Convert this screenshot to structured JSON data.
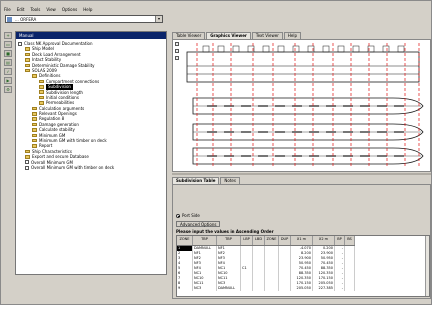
{
  "menu": [
    "File",
    "Edit",
    "Tools",
    "View",
    "Options",
    "Help"
  ],
  "project": {
    "name": "... ORFERA"
  },
  "toolbar_icons": [
    "new-icon",
    "open-icon",
    "save-icon",
    "print-icon",
    "check-icon",
    "run-icon",
    "settings-icon"
  ],
  "tree": {
    "header": "Manual",
    "items": [
      {
        "label": "Class NK Approval Documentation",
        "level": 0,
        "kind": "doc"
      },
      {
        "label": "Ship Model",
        "level": 1,
        "kind": "folder"
      },
      {
        "label": "Deck Load Arrangement",
        "level": 1,
        "kind": "folder"
      },
      {
        "label": "Intact Stability",
        "level": 1,
        "kind": "folder"
      },
      {
        "label": "Deterministic Damage Stability",
        "level": 1,
        "kind": "folder"
      },
      {
        "label": "SOLAS 2009",
        "level": 1,
        "kind": "folder"
      },
      {
        "label": "Definitions",
        "level": 2,
        "kind": "folder"
      },
      {
        "label": "Compartment connections",
        "level": 3,
        "kind": "folder"
      },
      {
        "label": "Subdivision",
        "level": 3,
        "kind": "folder",
        "selected": true
      },
      {
        "label": "Subdivision length",
        "level": 3,
        "kind": "folder"
      },
      {
        "label": "Initial conditions",
        "level": 3,
        "kind": "folder"
      },
      {
        "label": "Permeabilities",
        "level": 3,
        "kind": "folder"
      },
      {
        "label": "Calculation arguments",
        "level": 2,
        "kind": "folder"
      },
      {
        "label": "Relevant Openings",
        "level": 2,
        "kind": "folder"
      },
      {
        "label": "Regulation 8",
        "level": 2,
        "kind": "folder"
      },
      {
        "label": "Damage generation",
        "level": 2,
        "kind": "folder"
      },
      {
        "label": "Calculate stability",
        "level": 2,
        "kind": "folder"
      },
      {
        "label": "Minimum GM",
        "level": 2,
        "kind": "folder"
      },
      {
        "label": "Minimum GM with timber on deck",
        "level": 2,
        "kind": "folder"
      },
      {
        "label": "Report",
        "level": 2,
        "kind": "folder"
      },
      {
        "label": "Ship Characteristics",
        "level": 1,
        "kind": "folder"
      },
      {
        "label": "Export and secure Database",
        "level": 1,
        "kind": "folder"
      },
      {
        "label": "Overall Minimum GM",
        "level": 1,
        "kind": "doc"
      },
      {
        "label": "Overall Minimum GM with timber on deck",
        "level": 1,
        "kind": "doc"
      }
    ]
  },
  "tabs": [
    {
      "label": "Table Viewer",
      "active": false
    },
    {
      "label": "Graphics Viewer",
      "active": true
    },
    {
      "label": "Text Viewer",
      "active": false
    },
    {
      "label": "Help",
      "active": false
    }
  ],
  "lower_tabs": [
    {
      "label": "Subdivision Table",
      "active": true
    },
    {
      "label": "Notes",
      "active": false
    }
  ],
  "port_side": "Port Side",
  "advanced_button": "Advanced Options",
  "prompt": "Please input the values in Ascending Order",
  "grid": {
    "columns": [
      "ZONE",
      "TBP",
      "TBP",
      "LBP",
      "LBD",
      "ZONE",
      "DUP",
      "X1 m",
      "X2 m",
      "BP",
      "BS"
    ],
    "rows": [
      [
        "1",
        "DAMNULL",
        "NF1",
        "",
        "",
        "",
        "",
        "-4.070",
        "0.200",
        "-",
        ""
      ],
      [
        "2",
        "NF1",
        "NF2",
        "",
        "",
        "",
        "",
        "8.200",
        "23.900",
        "-",
        ""
      ],
      [
        "3",
        "NF2",
        "NF3",
        "",
        "",
        "",
        "",
        "23.900",
        "50.950",
        "-",
        ""
      ],
      [
        "4",
        "NF3",
        "NF4",
        "",
        "",
        "",
        "",
        "50.950",
        "70.450",
        "-",
        ""
      ],
      [
        "5",
        "NF4",
        "NC1",
        "C1",
        "",
        "",
        "",
        "70.450",
        "88.350",
        "-",
        ""
      ],
      [
        "6",
        "NC1",
        "NC10",
        "",
        "",
        "",
        "",
        "88.350",
        "120.350",
        "-",
        ""
      ],
      [
        "7",
        "NC10",
        "NC11",
        "",
        "",
        "",
        "",
        "120.350",
        "170.150",
        "-",
        ""
      ],
      [
        "8",
        "NC11",
        "NC3",
        "",
        "",
        "",
        "",
        "170.150",
        "205.050",
        "-",
        ""
      ],
      [
        "9",
        "NC3",
        "DAMNULL",
        "",
        "",
        "",
        "",
        "205.050",
        "227.385",
        "-",
        ""
      ]
    ]
  },
  "colors": {
    "title_bar": "#0a246a",
    "frame": "#d4d0c8",
    "hull_line": "#1a1a1a",
    "dash_red": "#e01010"
  }
}
